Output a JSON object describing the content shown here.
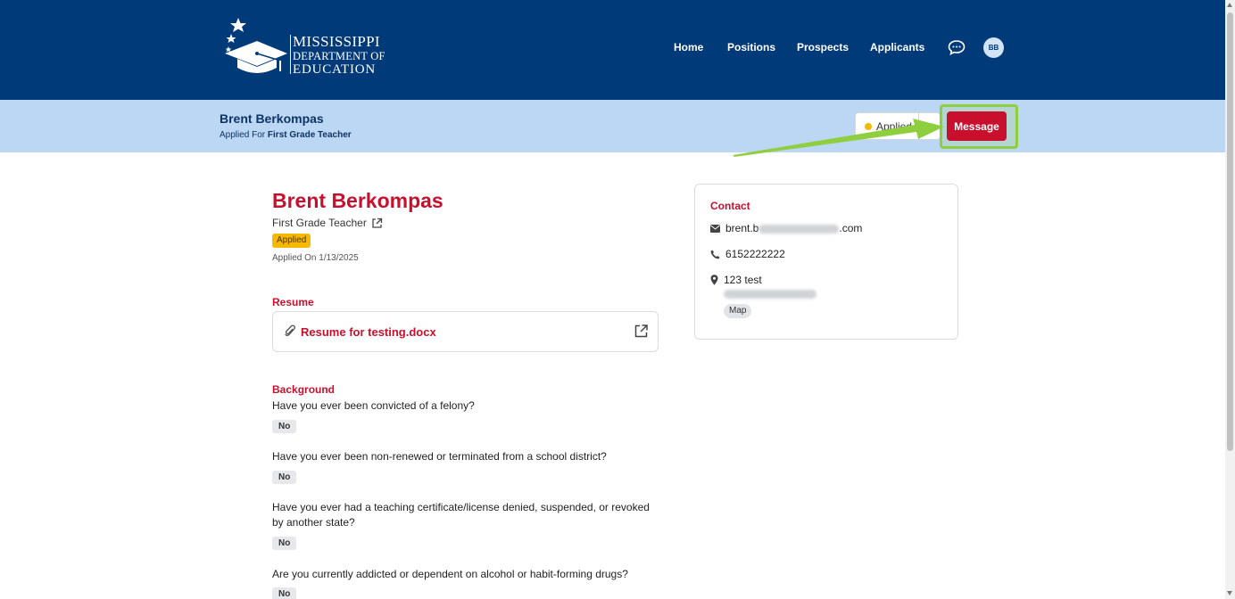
{
  "brand": {
    "line1": "MISSISSIPPI",
    "line2": "DEPARTMENT OF",
    "line3": "EDUCATION",
    "icon": "graduation-cap-stars-logo"
  },
  "nav": {
    "home": "Home",
    "positions": "Positions",
    "prospects": "Prospects",
    "applicants": "Applicants",
    "chat_icon": "chat-bubble-icon",
    "avatar_initials": "BB"
  },
  "subheader": {
    "name": "Brent Berkompas",
    "applied_for_label": "Applied For",
    "position": "First Grade Teacher",
    "status": "Applied",
    "status_color": "#f6b800",
    "message_button": "Message"
  },
  "candidate": {
    "name": "Brent Berkompas",
    "position": "First Grade Teacher",
    "status_badge": "Applied",
    "applied_on": "Applied On 1/13/2025"
  },
  "resume": {
    "title": "Resume",
    "file_name": "Resume for testing.docx"
  },
  "background": {
    "title": "Background",
    "questions": [
      {
        "q": "Have you ever been convicted of a felony?",
        "a": "No"
      },
      {
        "q": "Have you ever been non-renewed or terminated from a school district?",
        "a": "No"
      },
      {
        "q": "Have you ever had a teaching certificate/license denied, suspended, or revoked by another state?",
        "a": "No"
      },
      {
        "q": "Are you currently addicted or dependent on alcohol or habit-forming drugs?",
        "a": "No"
      }
    ]
  },
  "contact": {
    "title": "Contact",
    "email_start": "brent.b",
    "email_end": ".com",
    "phone": "6152222222",
    "address_line1": "123 test",
    "map_label": "Map"
  },
  "colors": {
    "nav_bg": "#003a78",
    "subbar_bg": "#bcd7f3",
    "accent_red": "#c8102e",
    "highlight_green": "#8fcf3f"
  }
}
